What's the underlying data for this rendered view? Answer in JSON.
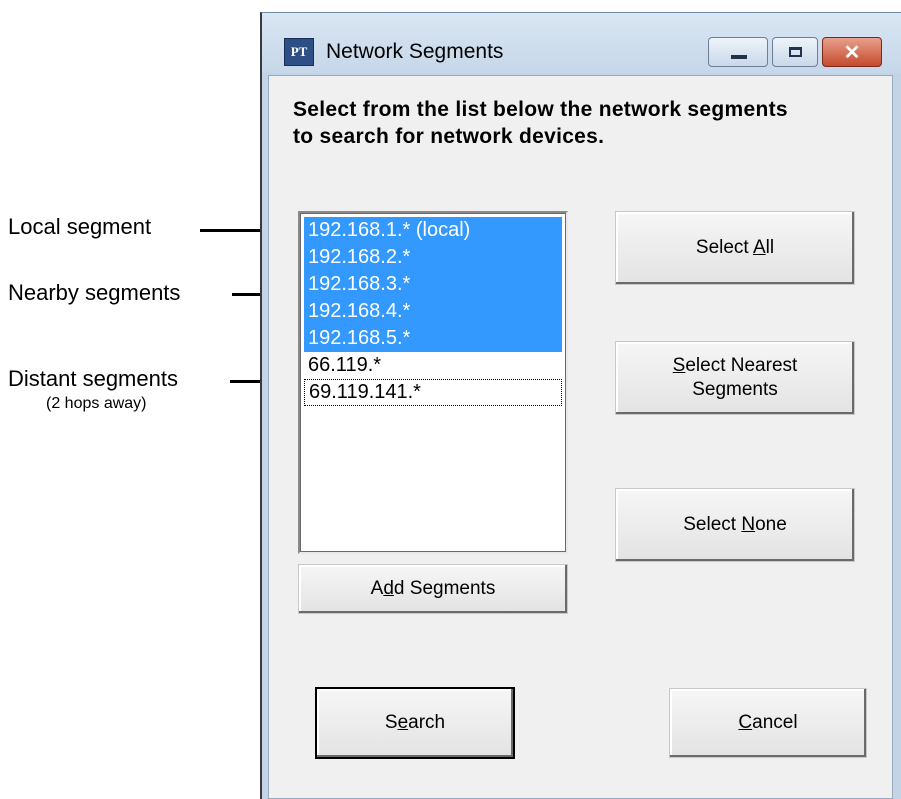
{
  "annotations": {
    "local": "Local segment",
    "nearby": "Nearby segments",
    "distant": "Distant segments",
    "distant_sub": "(2 hops away)"
  },
  "window": {
    "icon_text": "PT",
    "title": "Network Segments",
    "instruction": "Select from the list below the network segments\nto search for network devices."
  },
  "segments": [
    {
      "label": "192.168.1.* (local)",
      "selected": true
    },
    {
      "label": "192.168.2.*",
      "selected": true
    },
    {
      "label": "192.168.3.*",
      "selected": true
    },
    {
      "label": "192.168.4.*",
      "selected": true
    },
    {
      "label": "192.168.5.*",
      "selected": true
    },
    {
      "label": "66.119.*",
      "selected": false
    },
    {
      "label": "69.119.141.*",
      "selected": false,
      "focused": true
    }
  ],
  "buttons": {
    "select_all": {
      "before": "Select ",
      "mnemonic": "A",
      "after": "ll"
    },
    "select_nearest": {
      "before": "",
      "mnemonic": "S",
      "after": "elect Nearest",
      "line2": "Segments"
    },
    "select_none": {
      "before": "Select ",
      "mnemonic": "N",
      "after": "one"
    },
    "add_segments": {
      "before": "A",
      "mnemonic": "d",
      "after": "d Segments"
    },
    "search": {
      "before": "S",
      "mnemonic": "e",
      "after": "arch"
    },
    "cancel": {
      "before": "",
      "mnemonic": "C",
      "after": "ancel"
    }
  },
  "colors": {
    "selection": "#3399ff",
    "window_frame": "#c3d4e6",
    "close_button": "#c44a2c"
  }
}
